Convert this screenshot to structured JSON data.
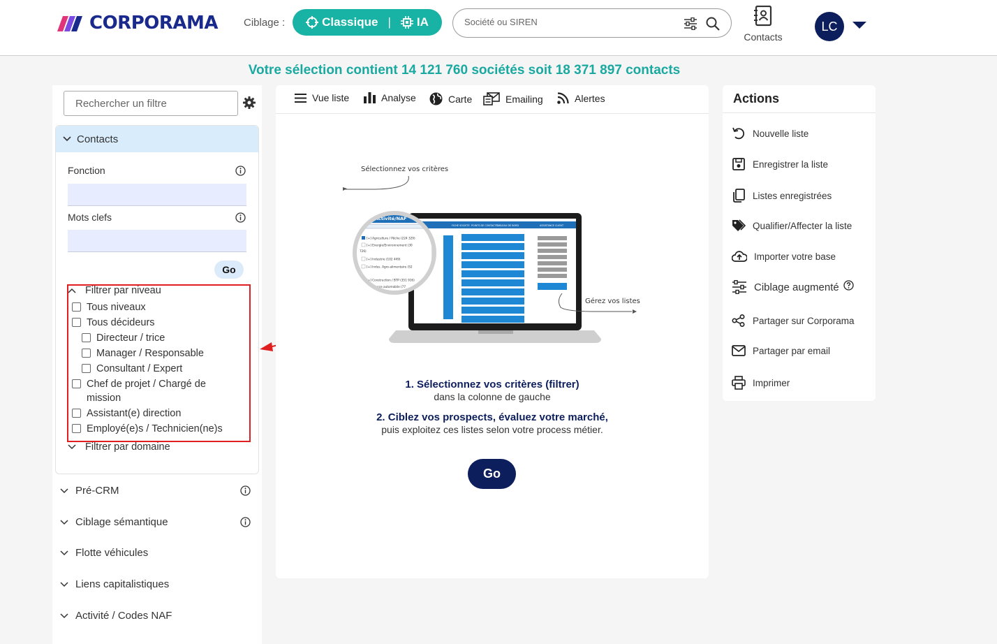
{
  "header": {
    "logo_text": "CORPORAMA",
    "ciblage_label": "Ciblage :",
    "ciblage_classique": "Classique",
    "ciblage_separator": "|",
    "ciblage_ia": "IA",
    "search_placeholder": "Société ou SIREN",
    "contacts_label": "Contacts",
    "avatar_initials": "LC"
  },
  "selection_summary": "Votre sélection contient 14 121 760 sociétés soit 18 371 897 contacts",
  "left_panel": {
    "filter_search_placeholder": "Rechercher un filtre",
    "contacts_section": "Contacts",
    "fonction_label": "Fonction",
    "mots_clefs_label": "Mots clefs",
    "go_label": "Go",
    "filtrer_par_niveau": "Filtrer par niveau",
    "levels": [
      "Tous niveaux",
      "Tous décideurs",
      "Directeur / trice",
      "Manager / Responsable",
      "Consultant / Expert",
      "Chef de projet / Chargé de mission",
      "Assistant(e) direction",
      "Employé(e)s / Technicien(ne)s"
    ],
    "filtrer_par_domaine": "Filtrer par domaine",
    "sections": [
      "Pré-CRM",
      "Ciblage sémantique",
      "Flotte véhicules",
      "Liens capitalistiques",
      "Activité / Codes NAF"
    ]
  },
  "tabs": [
    "Vue liste",
    "Analyse",
    "Carte",
    "Emailing",
    "Alertes"
  ],
  "illustration": {
    "caption_top": "Sélectionnez vos critères",
    "caption_right": "Gérez vos listes",
    "magnifier_header": "Activité/NAF",
    "magnifier_items": [
      "[+] Agriculture / Pêche (224 329)",
      "[+] Energie/Environnement (30",
      "726)",
      "[+] Industrie (102 449)",
      "[+] Indus. Agro-alimentaire (52",
      "[+] Construction / BTP (351 916)",
      "Commerce automobile (77"
    ],
    "screen_headers": [
      "FICHE SOCIETE",
      "POINTS DE CONTACTS",
      "TABLEAU DE BORD",
      "ASSISTANCE CLIENT"
    ]
  },
  "instructions": {
    "step1_title": "1. Sélectionnez vos critères (filtrer)",
    "step1_sub": "dans la colonne de gauche",
    "step2_title": "2. Ciblez vos prospects, évaluez votre marché,",
    "step2_sub": "puis exploitez ces listes selon votre process métier.",
    "go_label": "Go"
  },
  "actions": {
    "title": "Actions",
    "items": [
      "Nouvelle liste",
      "Enregistrer la liste",
      "Listes enregistrées",
      "Qualifier/Affecter la liste",
      "Importer votre base",
      "Ciblage augmenté",
      "Partager sur Corporama",
      "Partager par email",
      "Imprimer"
    ]
  },
  "colors": {
    "teal": "#19b3a6",
    "navy": "#0d1e5c",
    "highlight_red": "#e02020",
    "contacts_head_bg": "#d8ecfb"
  }
}
